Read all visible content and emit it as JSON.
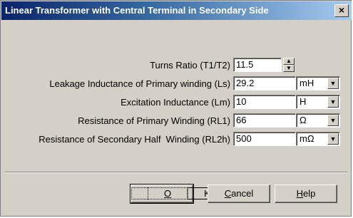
{
  "window": {
    "title": "Linear Transformer with Central Terminal in Secondary Side",
    "close_glyph": "×"
  },
  "fields": {
    "turns_ratio": {
      "label": "Turns Ratio (T1/T2)",
      "value": "11.5"
    },
    "leakage_inductance": {
      "label": "Leakage Inductance of Primary winding (Ls)",
      "value": "29.2",
      "unit": "mH"
    },
    "excitation_inductance": {
      "label": "Excitation Inductance (Lm)",
      "value": "10",
      "unit": "H"
    },
    "resistance_primary": {
      "label": "Resistance of Primary Winding (RL1)",
      "value": "66",
      "unit": "Ω"
    },
    "resistance_secondary_half": {
      "label": "Resistance of Secondary Half  Winding (RL2h)",
      "value": "500",
      "unit": "mΩ"
    }
  },
  "buttons": {
    "ok": {
      "accel": "O",
      "rest": "K"
    },
    "cancel": {
      "accel": "C",
      "rest": "ancel"
    },
    "help": {
      "accel": "H",
      "rest": "elp"
    }
  },
  "icons": {
    "spin_up": "▲",
    "spin_down": "▼",
    "dropdown": "▼"
  }
}
